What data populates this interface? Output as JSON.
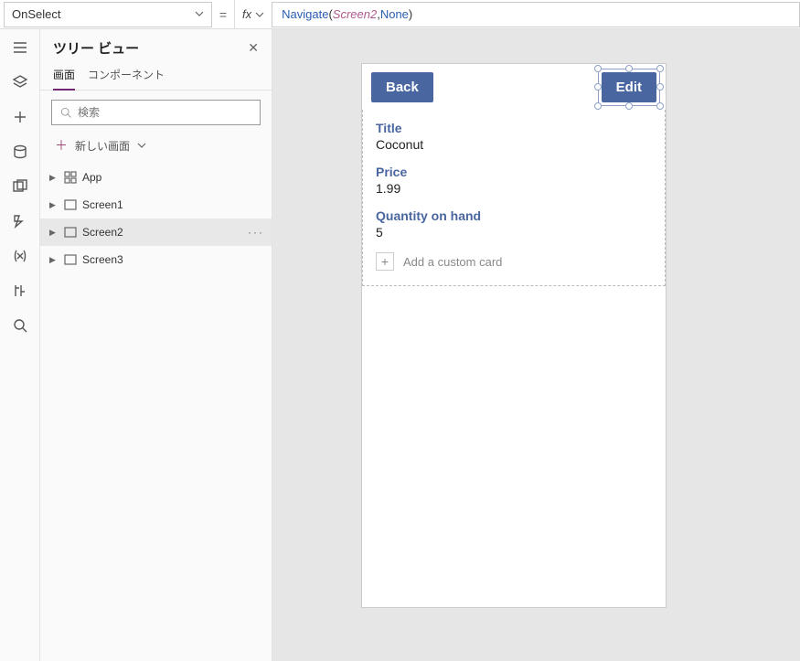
{
  "formula": {
    "property": "OnSelect",
    "fx_label": "fx",
    "expr": {
      "fn": "Navigate",
      "open": "( ",
      "id": "Screen2",
      "sep": ", ",
      "kw": "None",
      "close": " )"
    }
  },
  "tree": {
    "title": "ツリー ビュー",
    "tabs": {
      "screens": "画面",
      "components": "コンポーネント"
    },
    "search_placeholder": "検索",
    "new_screen": "新しい画面",
    "items": [
      {
        "label": "App"
      },
      {
        "label": "Screen1"
      },
      {
        "label": "Screen2"
      },
      {
        "label": "Screen3"
      }
    ]
  },
  "canvas": {
    "back_label": "Back",
    "edit_label": "Edit",
    "cards": [
      {
        "label": "Title",
        "value": "Coconut"
      },
      {
        "label": "Price",
        "value": "1.99"
      },
      {
        "label": "Quantity on hand",
        "value": "5"
      }
    ],
    "add_card": "Add a custom card"
  }
}
